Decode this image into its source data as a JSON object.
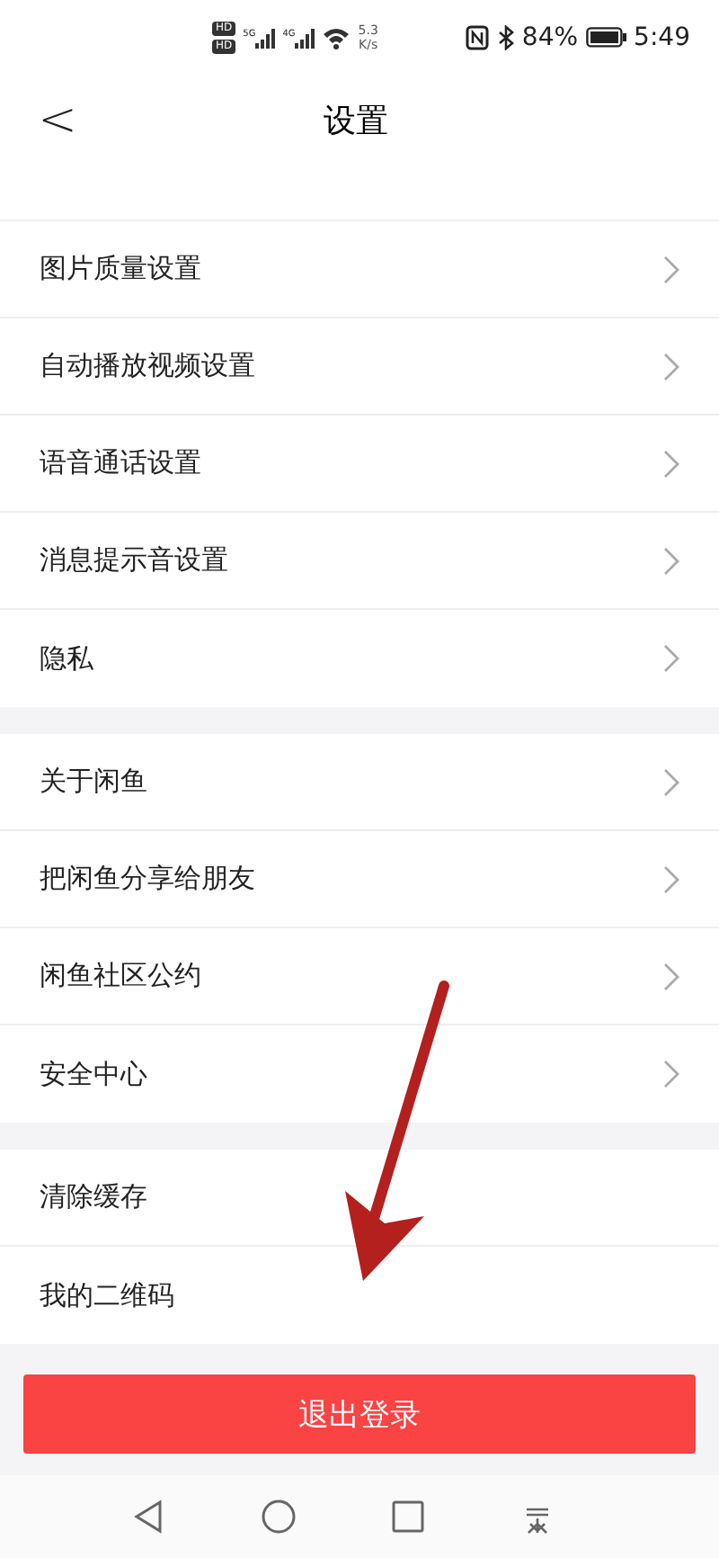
{
  "status_bar": {
    "hd_badges": [
      "HD",
      "HD"
    ],
    "networks": [
      "5G",
      "4G"
    ],
    "speed": [
      "5.3",
      "K/s"
    ],
    "battery": "84%",
    "time": "5:49"
  },
  "header": {
    "back": "<",
    "title": "设置"
  },
  "groups": [
    {
      "items": [
        {
          "label": "图片质量设置",
          "chevron": true
        },
        {
          "label": "自动播放视频设置",
          "chevron": true
        },
        {
          "label": "语音通话设置",
          "chevron": true
        },
        {
          "label": "消息提示音设置",
          "chevron": true
        },
        {
          "label": "隐私",
          "chevron": true
        }
      ]
    },
    {
      "items": [
        {
          "label": "关于闲鱼",
          "chevron": true
        },
        {
          "label": "把闲鱼分享给朋友",
          "chevron": true
        },
        {
          "label": "闲鱼社区公约",
          "chevron": true
        },
        {
          "label": "安全中心",
          "chevron": true
        }
      ]
    },
    {
      "items": [
        {
          "label": "清除缓存",
          "chevron": false
        },
        {
          "label": "我的二维码",
          "chevron": false
        }
      ]
    }
  ],
  "logout": "退出登录",
  "annotation": {
    "kind": "arrow"
  }
}
